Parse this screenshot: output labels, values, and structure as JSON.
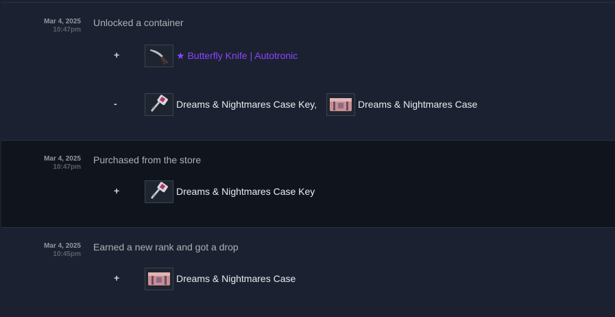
{
  "rows": [
    {
      "date": "Mar 4, 2025",
      "time": "10:47pm",
      "description": "Unlocked a container",
      "plus_sign": "+",
      "plus_items": [
        {
          "name": "★ Butterfly Knife | Autotronic",
          "icon": "butterfly-knife-icon",
          "color": "#8847ff"
        }
      ],
      "minus_sign": "-",
      "minus_items": [
        {
          "name": "Dreams & Nightmares Case Key,",
          "icon": "case-key-icon"
        },
        {
          "name": "Dreams & Nightmares Case",
          "icon": "weapon-case-icon"
        }
      ]
    },
    {
      "date": "Mar 4, 2025",
      "time": "10:47pm",
      "description": "Purchased from the store",
      "plus_sign": "+",
      "plus_items": [
        {
          "name": "Dreams & Nightmares Case Key",
          "icon": "case-key-icon"
        }
      ]
    },
    {
      "date": "Mar 4, 2025",
      "time": "10:45pm",
      "description": "Earned a new rank and got a drop",
      "plus_sign": "+",
      "plus_items": [
        {
          "name": "Dreams & Nightmares Case",
          "icon": "weapon-case-icon"
        }
      ]
    }
  ]
}
